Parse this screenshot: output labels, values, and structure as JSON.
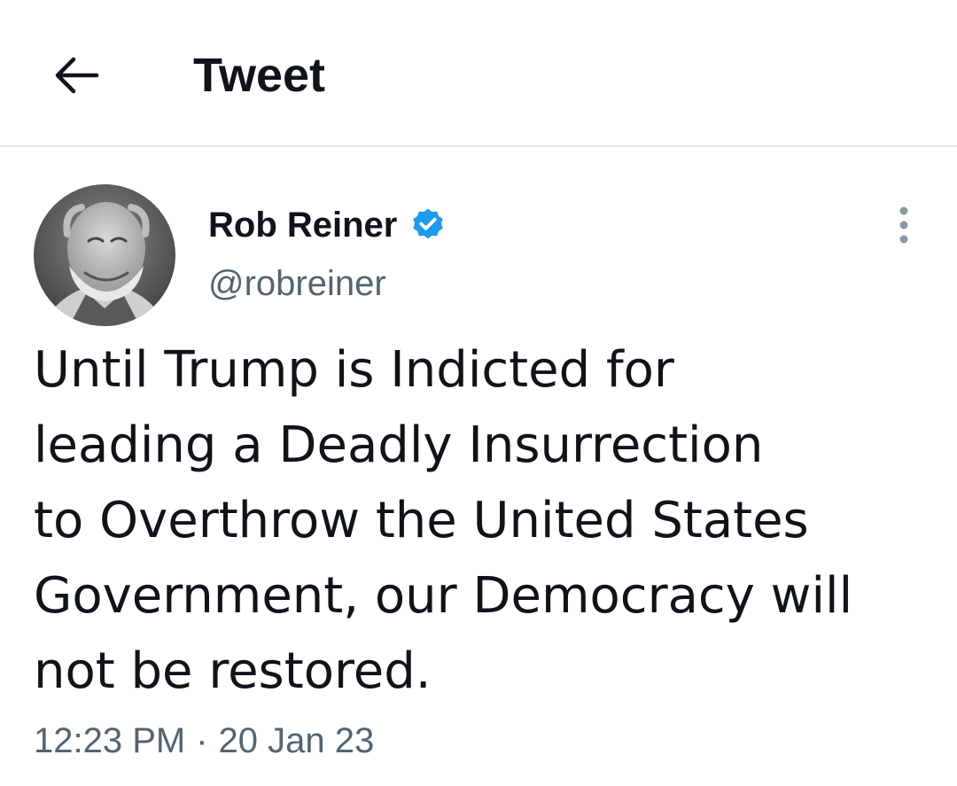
{
  "header": {
    "title": "Tweet",
    "back_icon": "arrow-left-icon"
  },
  "tweet": {
    "author": {
      "name": "Rob Reiner",
      "handle": "@robreiner",
      "verified": true,
      "avatar_icon": "avatar-photo"
    },
    "more_icon": "vertical-ellipsis-icon",
    "text": "Until Trump is Indicted for\nleading a Deadly Insurrection\nto Overthrow the United States\nGovernment, our Democracy will\nnot be restored.",
    "time": "12:23 PM",
    "separator": "·",
    "date": "20 Jan 23"
  },
  "colors": {
    "text_primary": "#0f1419",
    "text_secondary": "#536471",
    "verified_blue": "#1d9bf0",
    "divider": "#e3e8eb"
  }
}
